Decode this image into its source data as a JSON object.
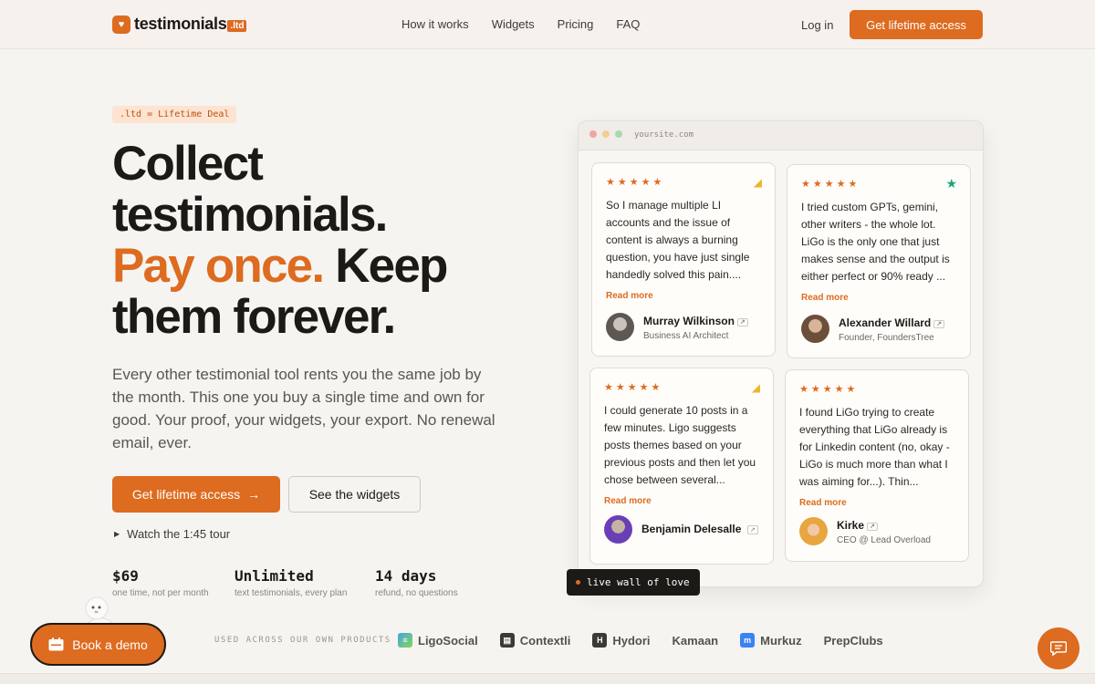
{
  "brand": {
    "name": "testimonials",
    "badge": ".ltd"
  },
  "nav": {
    "links": [
      "How it works",
      "Widgets",
      "Pricing",
      "FAQ"
    ],
    "login": "Log in",
    "cta": "Get lifetime access"
  },
  "hero": {
    "pill": ".ltd = Lifetime Deal",
    "h1_line1": "Collect",
    "h1_line2": "testimonials.",
    "h1_accent": "Pay once.",
    "h1_line3_rest": " Keep",
    "h1_line4": "them forever.",
    "paragraph": "Every other testimonial tool rents you the same job by the month. This one you buy a single time and own for good. Your proof, your widgets, your export. No renewal email, ever.",
    "primary_button": "Get lifetime access",
    "secondary_button": "See the widgets",
    "tour": "Watch the 1:45 tour"
  },
  "stats": [
    {
      "value": "$69",
      "label": "one time, not per month"
    },
    {
      "value": "Unlimited",
      "label": "text testimonials, every plan"
    },
    {
      "value": "14 days",
      "label": "refund, no questions"
    }
  ],
  "browser": {
    "url": "yoursite.com"
  },
  "testimonials": [
    {
      "stars": "★★★★★",
      "icon": "cheese-wedge-icon",
      "quote": "So I manage multiple LI accounts and the issue of content is always a burning question, you have just single handedly solved this pain....",
      "read_more": "Read more",
      "name": "Murray Wilkinson",
      "role": "Business AI Architect"
    },
    {
      "stars": "★★★★★",
      "icon": "green-star-icon",
      "quote": "I tried custom GPTs, gemini, other writers - the whole lot. LiGo is the only one that just makes sense and the output is either perfect or 90% ready ...",
      "read_more": "Read more",
      "name": "Alexander Willard",
      "role": "Founder, FoundersTree"
    },
    {
      "stars": "★★★★★",
      "icon": "cheese-wedge-icon",
      "quote": "I could generate 10 posts in a few minutes. Ligo suggests posts themes based on your previous posts and then let you chose between several...",
      "read_more": "Read more",
      "name": "Benjamin Delesalle",
      "role": ""
    },
    {
      "stars": "★★★★★",
      "icon": "",
      "quote": "I found LiGo trying to create everything that LiGo already is for Linkedin content (no, okay - LiGo is much more than what I was aiming for...). Thin...",
      "read_more": "Read more",
      "name": "Kirke",
      "role": "CEO @ Lead Overload"
    }
  ],
  "live_badge": "live wall of love",
  "demo_button": "Book a demo",
  "used_label": "USED ACROSS OUR OWN PRODUCTS",
  "products": [
    "LigoSocial",
    "Contextli",
    "Hydori",
    "Kamaan",
    "Murkuz",
    "PrepClubs"
  ],
  "colors": {
    "accent": "#dd6b20",
    "background": "#f6f4f1",
    "dark": "#1c1a17"
  }
}
